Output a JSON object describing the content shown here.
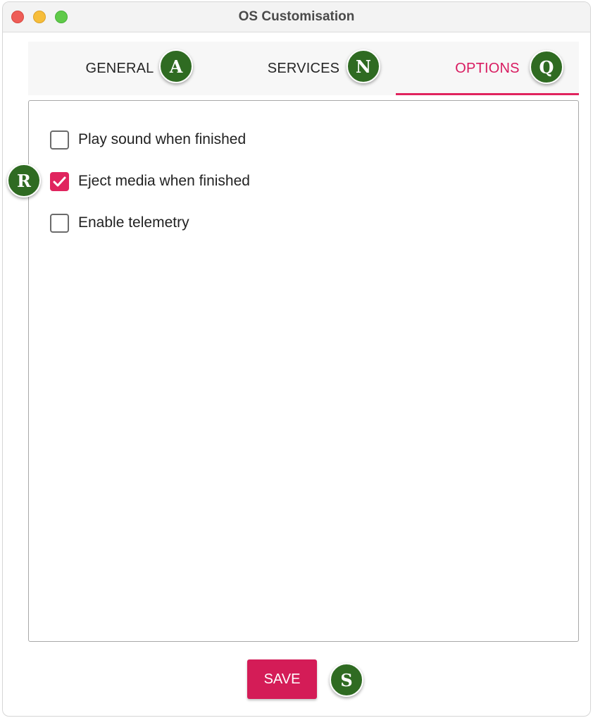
{
  "window": {
    "title": "OS Customisation"
  },
  "tabs": [
    {
      "label": "GENERAL",
      "active": false
    },
    {
      "label": "SERVICES",
      "active": false
    },
    {
      "label": "OPTIONS",
      "active": true
    }
  ],
  "options": [
    {
      "label": "Play sound when finished",
      "checked": false
    },
    {
      "label": "Eject media when finished",
      "checked": true
    },
    {
      "label": "Enable telemetry",
      "checked": false
    }
  ],
  "footer": {
    "save_label": "SAVE"
  },
  "markers": {
    "general": "A",
    "services": "N",
    "options": "Q",
    "eject": "R",
    "save": "S"
  },
  "colors": {
    "accent": "#e0245e",
    "marker_bg": "#2f6b22",
    "save_button": "#d41c57"
  },
  "icons": {
    "checkbox_checked": "checkmark-icon"
  }
}
